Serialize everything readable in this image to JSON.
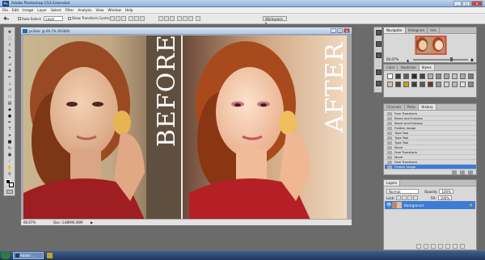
{
  "app": {
    "title": "Adobe Photoshop CS3 Extended"
  },
  "menu": [
    "File",
    "Edit",
    "Image",
    "Layer",
    "Select",
    "Filter",
    "Analysis",
    "View",
    "Window",
    "Help"
  ],
  "options": {
    "auto_select_label": "Auto-Select:",
    "auto_select_value": "Layer",
    "show_transform_label": "Show Transform Controls",
    "workspace_label": "Workspace"
  },
  "document": {
    "title": "ps3doc @ 66.7% (RGB/8)",
    "before_label": "BEFORE",
    "after_label": "AFTER",
    "zoom": "66.67%",
    "doc_info": "Doc: 3.86M/6.06M"
  },
  "navigator": {
    "tabs": [
      "Navigator",
      "Histogram",
      "Info"
    ],
    "zoom": "66.67%"
  },
  "styles": {
    "tabs": [
      "Color",
      "Swatches",
      "Styles"
    ]
  },
  "history": {
    "tabs": [
      "Channels",
      "Paths",
      "History"
    ],
    "items": [
      "Free Transform",
      "Bevel and Emboss",
      "Bevel and Emboss",
      "Flatten Image",
      "Type Tool",
      "Type Tool",
      "Type Tool",
      "Move",
      "Free Transform",
      "Move",
      "Free Transform",
      "Flatten Image"
    ],
    "selected_index": 11
  },
  "layers": {
    "tabs": [
      "Layers"
    ],
    "blend_mode": "Normal",
    "opacity_label": "Opacity:",
    "opacity": "100%",
    "lock_label": "Lock:",
    "fill_label": "Fill:",
    "fill": "100%",
    "layer_name": "Background"
  },
  "taskbar": {
    "start": "",
    "task": "Adobe ..."
  },
  "colors": {
    "accent": "#3c7bd6",
    "history_selected": "#3c7bd6"
  }
}
